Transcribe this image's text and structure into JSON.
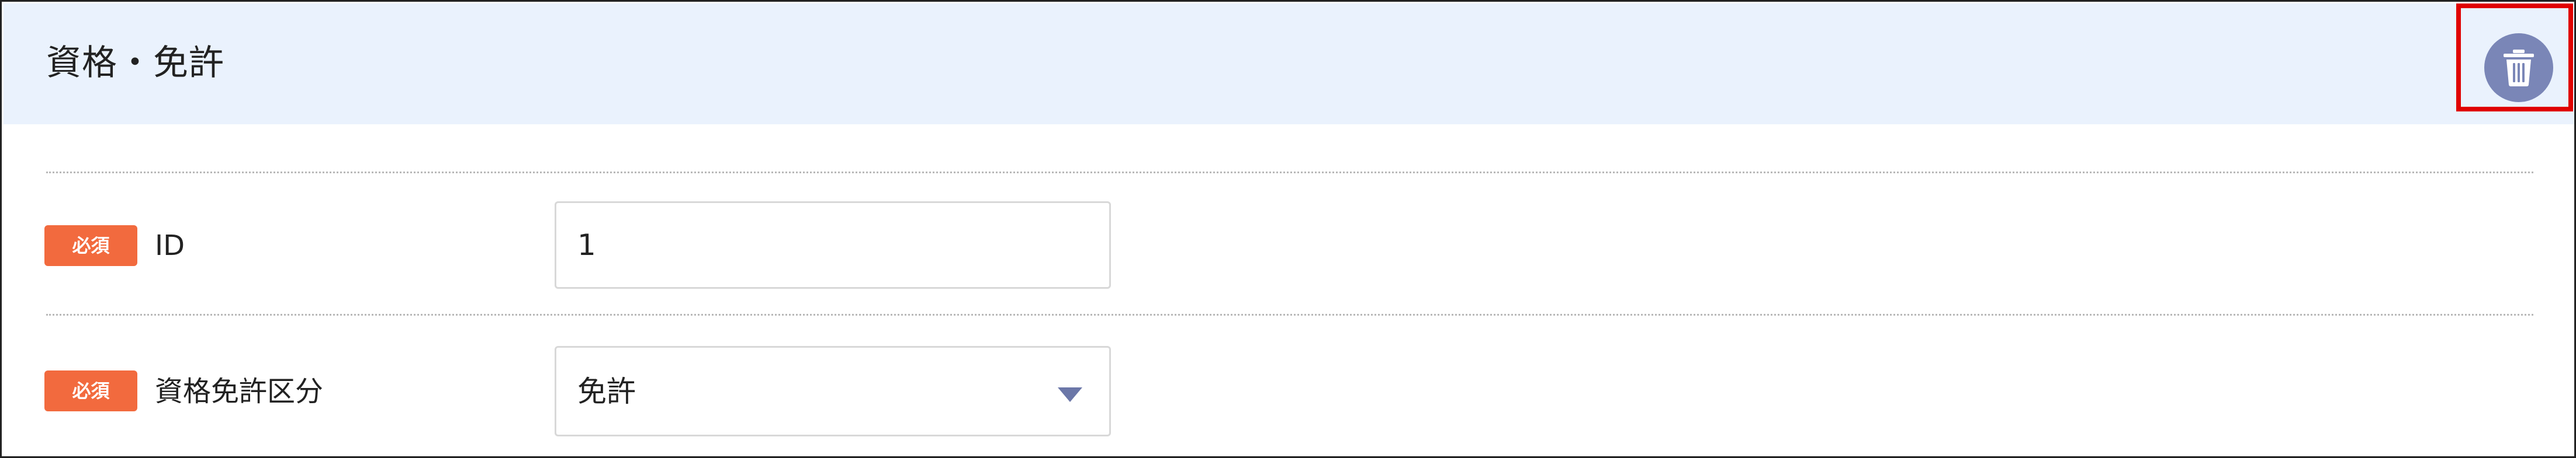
{
  "section": {
    "title": "資格・免許",
    "delete_icon": "trash-icon"
  },
  "colors": {
    "header_background": "#eaf2fd",
    "required_badge": "#f26a3e",
    "delete_button": "#7a86b7",
    "highlight": "#e00000"
  },
  "fields": [
    {
      "required_label": "必須",
      "label": "ID",
      "value": "1"
    },
    {
      "required_label": "必須",
      "label": "資格免許区分",
      "selected": "免許"
    }
  ]
}
